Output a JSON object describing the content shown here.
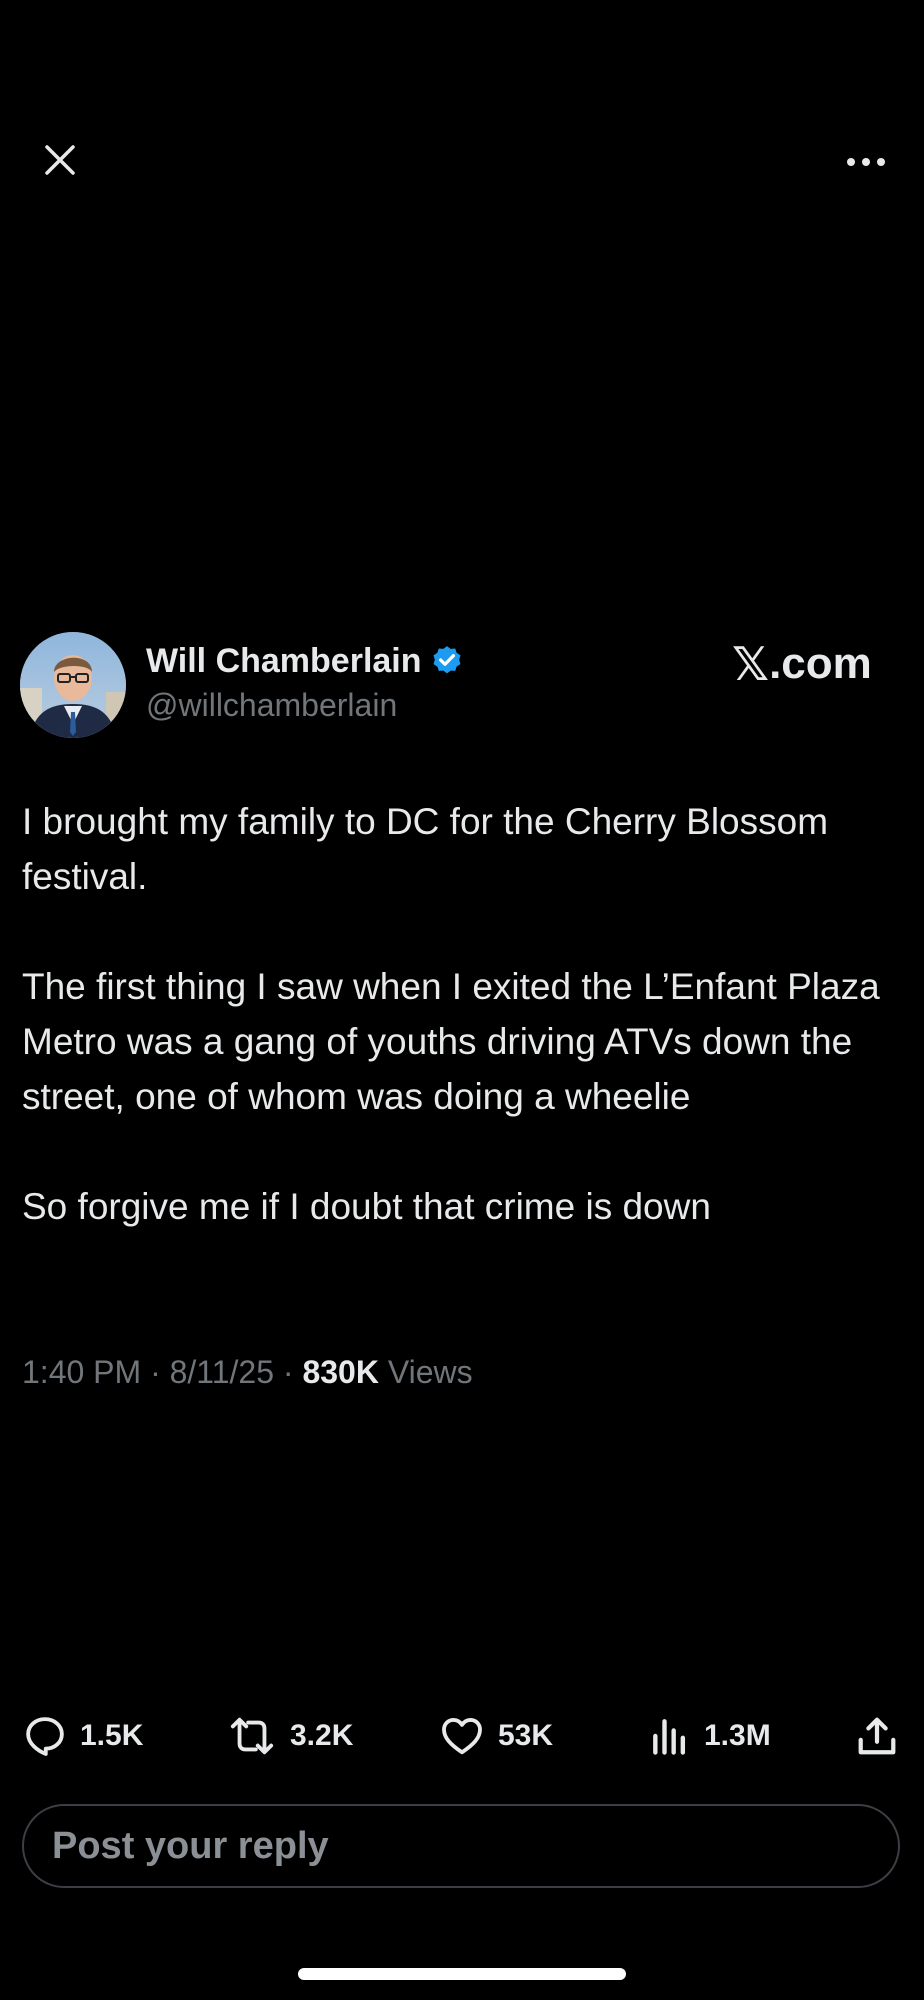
{
  "nav": {
    "close_icon": "close-icon",
    "more_icon": "more-icon"
  },
  "author": {
    "name": "Will Chamberlain",
    "handle": "@willchamberlain",
    "verified": true,
    "verified_color": "#1d9bf0"
  },
  "brand": {
    "x_glyph": "𝕏",
    "suffix": ".com"
  },
  "post": {
    "paragraphs": [
      "I brought my family to DC for the Cherry Blossom festival.",
      "The first thing I saw when I exited the L’Enfant Plaza Metro was a gang of youths driving ATVs down the street, one of whom was doing a wheelie",
      "So forgive me if I doubt that crime is down"
    ],
    "time": "1:40 PM",
    "date": "8/11/25",
    "separator": "·",
    "views_count": "830K",
    "views_label": "Views"
  },
  "actions": {
    "replies": "1.5K",
    "reposts": "3.2K",
    "likes": "53K",
    "views": "1.3M"
  },
  "reply": {
    "placeholder": "Post your reply"
  },
  "colors": {
    "background": "#000000",
    "text": "#e7e9ea",
    "muted": "#71767b"
  }
}
